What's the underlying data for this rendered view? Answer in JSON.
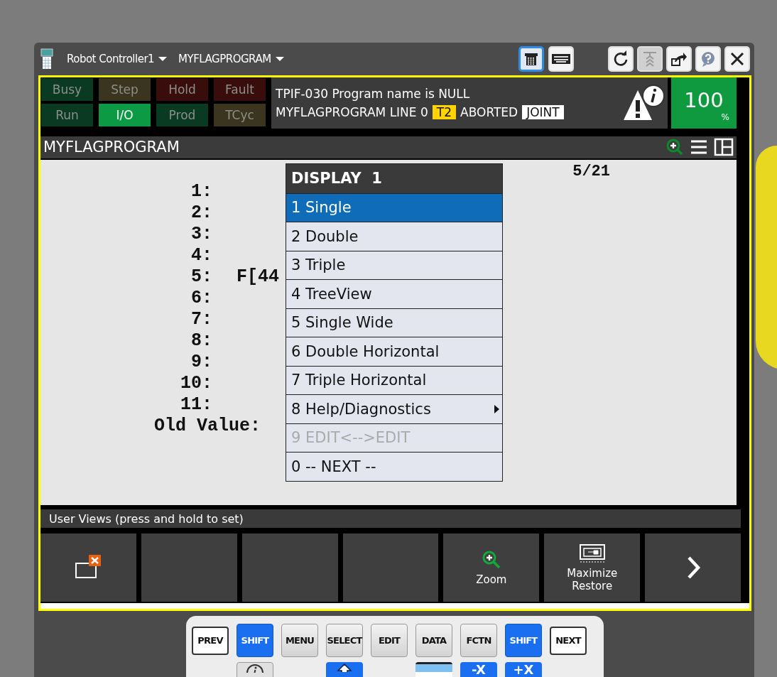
{
  "window": {
    "controller": "Robot Controller1",
    "program": "MYFLAGPROGRAM",
    "view_buttons": [
      {
        "kind": "pendant",
        "selected": true
      },
      {
        "kind": "keyboard",
        "selected": false
      }
    ],
    "tool_buttons": [
      {
        "kind": "refresh",
        "disabled": false
      },
      {
        "kind": "stack",
        "disabled": true
      },
      {
        "kind": "export",
        "disabled": false
      },
      {
        "kind": "help",
        "disabled": false
      },
      {
        "kind": "close",
        "disabled": false
      }
    ]
  },
  "status_lamps": [
    {
      "label": "Busy",
      "kind": "go",
      "on": false
    },
    {
      "label": "Step",
      "kind": "caution",
      "on": false
    },
    {
      "label": "Hold",
      "kind": "alarm",
      "on": false
    },
    {
      "label": "Fault",
      "kind": "alarm",
      "on": false
    },
    {
      "label": "Run",
      "kind": "go",
      "on": false
    },
    {
      "label": "I/O",
      "kind": "go",
      "on": true
    },
    {
      "label": "Prod",
      "kind": "go",
      "on": false
    },
    {
      "label": "TCyc",
      "kind": "caution",
      "on": false
    }
  ],
  "message": {
    "line_1": "TPIF-030  Program name is NULL",
    "program_line": "MYFLAGPROGRAM LINE 0",
    "mode": "T2",
    "state": "ABORTED",
    "coord": "JOINT"
  },
  "override": {
    "value": "100",
    "unit": "%"
  },
  "editor": {
    "title": "MYFLAGPROGRAM",
    "position": "5/21",
    "lines": [
      {
        "number": "1:"
      },
      {
        "number": "2:"
      },
      {
        "number": "3:"
      },
      {
        "number": "4:"
      },
      {
        "number": "5:",
        "text": "F[44"
      },
      {
        "number": "6:"
      },
      {
        "number": "7:"
      },
      {
        "number": "8:"
      },
      {
        "number": "9:"
      },
      {
        "number": "10:"
      },
      {
        "number": "11:"
      }
    ],
    "old_value": "Old Value:"
  },
  "menu": {
    "title": "DISPLAY  1",
    "items": [
      {
        "label": "1 Single",
        "selected": true,
        "disabled": false,
        "submenu": false
      },
      {
        "label": "2 Double",
        "selected": false,
        "disabled": false,
        "submenu": false
      },
      {
        "label": "3 Triple",
        "selected": false,
        "disabled": false,
        "submenu": false
      },
      {
        "label": "4 TreeView",
        "selected": false,
        "disabled": false,
        "submenu": false
      },
      {
        "label": "5 Single Wide",
        "selected": false,
        "disabled": false,
        "submenu": false
      },
      {
        "label": "6 Double Horizontal",
        "selected": false,
        "disabled": false,
        "submenu": false
      },
      {
        "label": "7 Triple Horizontal",
        "selected": false,
        "disabled": false,
        "submenu": false
      },
      {
        "label": "8 Help/Diagnostics",
        "selected": false,
        "disabled": false,
        "submenu": true
      },
      {
        "label": "9 EDIT<-->EDIT",
        "selected": false,
        "disabled": true,
        "submenu": false
      },
      {
        "label": "0 -- NEXT --",
        "selected": false,
        "disabled": false,
        "submenu": false
      }
    ]
  },
  "user_views": {
    "hint": "User Views (press and hold to set)"
  },
  "function_keys": [
    {
      "kind": "close-window"
    },
    {
      "kind": "empty"
    },
    {
      "kind": "empty"
    },
    {
      "kind": "empty"
    },
    {
      "kind": "zoom",
      "label": "Zoom"
    },
    {
      "kind": "maximize",
      "label": "Maximize\nRestore"
    },
    {
      "kind": "next"
    }
  ],
  "keypad": {
    "row_1": [
      {
        "label": "PREV",
        "kind": "nav"
      },
      {
        "label": "SHIFT",
        "kind": "shift"
      },
      {
        "label": "MENU",
        "kind": "key"
      },
      {
        "label": "SELECT",
        "kind": "key"
      },
      {
        "label": "EDIT",
        "kind": "key"
      },
      {
        "label": "DATA",
        "kind": "key"
      },
      {
        "label": "FCTN",
        "kind": "key"
      },
      {
        "label": "SHIFT",
        "kind": "shift"
      },
      {
        "label": "NEXT",
        "kind": "nav"
      }
    ],
    "row_2": [
      {
        "kind": "blank"
      },
      {
        "kind": "info"
      },
      {
        "kind": "blank"
      },
      {
        "kind": "up"
      },
      {
        "kind": "blank"
      },
      {
        "kind": "step"
      },
      {
        "kind": "axis",
        "label": "-X"
      },
      {
        "kind": "axis",
        "label": "+X"
      },
      {
        "kind": "blank"
      }
    ]
  }
}
